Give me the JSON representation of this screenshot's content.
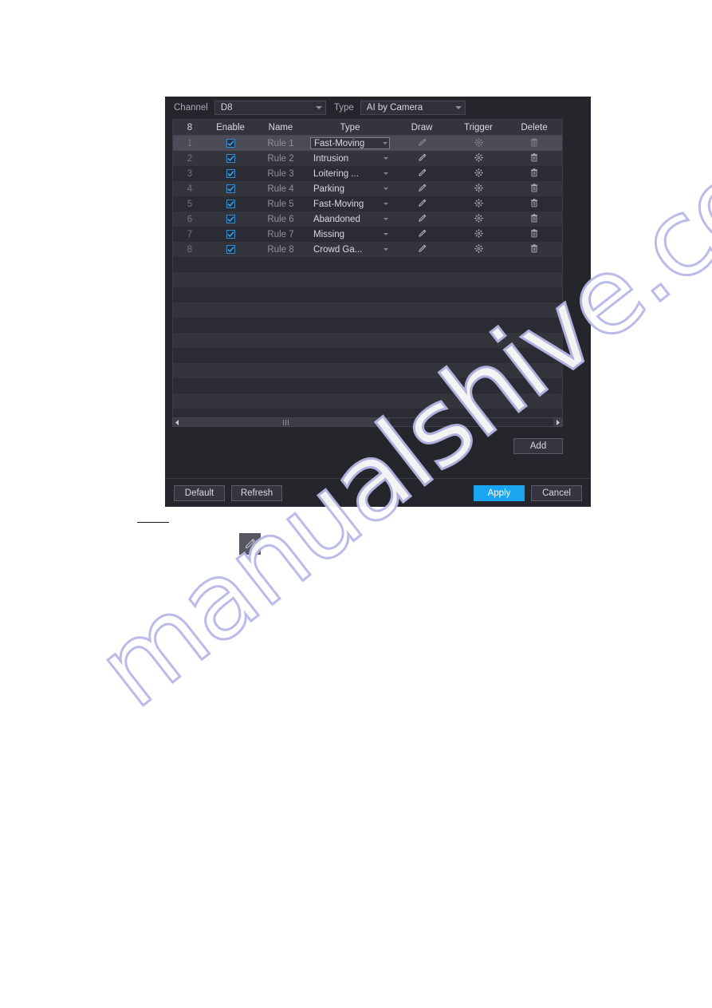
{
  "watermark": {
    "text": "manualshive.com"
  },
  "dialog": {
    "filters": {
      "channel_label": "Channel",
      "channel_value": "D8",
      "type_label": "Type",
      "type_value": "AI by Camera"
    },
    "table": {
      "headers": {
        "count": "8",
        "enable": "Enable",
        "name": "Name",
        "type": "Type",
        "draw": "Draw",
        "trigger": "Trigger",
        "delete": "Delete"
      },
      "rows": [
        {
          "index": "1",
          "enabled": true,
          "name": "Rule 1",
          "type": "Fast-Moving",
          "selected": true
        },
        {
          "index": "2",
          "enabled": true,
          "name": "Rule 2",
          "type": "Intrusion",
          "selected": false
        },
        {
          "index": "3",
          "enabled": true,
          "name": "Rule 3",
          "type": "Loitering ...",
          "selected": false
        },
        {
          "index": "4",
          "enabled": true,
          "name": "Rule 4",
          "type": "Parking",
          "selected": false
        },
        {
          "index": "5",
          "enabled": true,
          "name": "Rule 5",
          "type": "Fast-Moving",
          "selected": false
        },
        {
          "index": "6",
          "enabled": true,
          "name": "Rule 6",
          "type": "Abandoned",
          "selected": false
        },
        {
          "index": "7",
          "enabled": true,
          "name": "Rule 7",
          "type": "Missing",
          "selected": false
        },
        {
          "index": "8",
          "enabled": true,
          "name": "Rule 8",
          "type": "Crowd Ga...",
          "selected": false
        }
      ],
      "empty_row_count": 14
    },
    "add_label": "Add",
    "footer": {
      "default_label": "Default",
      "refresh_label": "Refresh",
      "apply_label": "Apply",
      "cancel_label": "Cancel"
    }
  },
  "colors": {
    "accent": "#19a5ef",
    "checkbox": "#2f8fd0",
    "dialog_bg": "#25252c",
    "row_odd": "#2b2b33",
    "row_even": "#34343d",
    "row_selected": "#4b4c57",
    "watermark": "#b7b8e8"
  }
}
